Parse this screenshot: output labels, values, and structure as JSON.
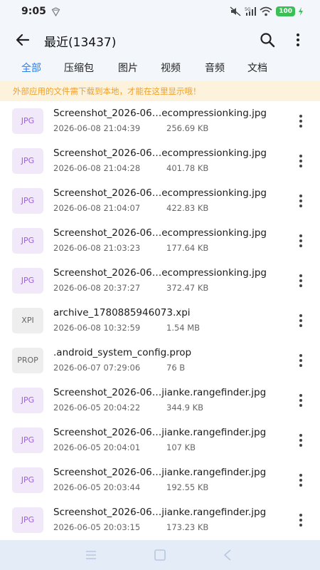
{
  "status": {
    "time": "9:05",
    "battery": "100",
    "network": "5G"
  },
  "header": {
    "title": "最近(13437)"
  },
  "tabs": [
    {
      "label": "全部",
      "active": true
    },
    {
      "label": "压缩包",
      "active": false
    },
    {
      "label": "图片",
      "active": false
    },
    {
      "label": "视频",
      "active": false
    },
    {
      "label": "音频",
      "active": false
    },
    {
      "label": "文档",
      "active": false
    }
  ],
  "notice": "外部应用的文件需下载到本地，才能在这里显示哦！",
  "files": [
    {
      "type": "JPG",
      "name": "Screenshot_2026-06…ecompressionking.jpg",
      "date": "2026-06-08 21:04:39",
      "size": "256.69 KB"
    },
    {
      "type": "JPG",
      "name": "Screenshot_2026-06…ecompressionking.jpg",
      "date": "2026-06-08 21:04:28",
      "size": "401.78 KB"
    },
    {
      "type": "JPG",
      "name": "Screenshot_2026-06…ecompressionking.jpg",
      "date": "2026-06-08 21:04:07",
      "size": "422.83 KB"
    },
    {
      "type": "JPG",
      "name": "Screenshot_2026-06…ecompressionking.jpg",
      "date": "2026-06-08 21:03:23",
      "size": "177.64 KB"
    },
    {
      "type": "JPG",
      "name": "Screenshot_2026-06…ecompressionking.jpg",
      "date": "2026-06-08 20:37:27",
      "size": "372.47 KB"
    },
    {
      "type": "XPI",
      "name": "archive_1780885946073.xpi",
      "date": "2026-06-08 10:32:59",
      "size": "1.54 MB"
    },
    {
      "type": "PROP",
      "name": ".android_system_config.prop",
      "date": "2026-06-07 07:29:06",
      "size": "76 B"
    },
    {
      "type": "JPG",
      "name": "Screenshot_2026-06…jianke.rangefinder.jpg",
      "date": "2026-06-05 20:04:22",
      "size": "344.9 KB"
    },
    {
      "type": "JPG",
      "name": "Screenshot_2026-06…jianke.rangefinder.jpg",
      "date": "2026-06-05 20:04:01",
      "size": "107 KB"
    },
    {
      "type": "JPG",
      "name": "Screenshot_2026-06…jianke.rangefinder.jpg",
      "date": "2026-06-05 20:03:44",
      "size": "192.55 KB"
    },
    {
      "type": "JPG",
      "name": "Screenshot_2026-06…jianke.rangefinder.jpg",
      "date": "2026-06-05 20:03:15",
      "size": "173.23 KB"
    }
  ],
  "colors": {
    "accent": "#2a7ef0",
    "notice_bg": "#fdf3dd",
    "notice_text": "#f0a02a",
    "jpg_badge_bg": "#f1e9f9",
    "jpg_badge_text": "#9a5fd6"
  },
  "icons": {
    "back": "arrow-left-icon",
    "search": "search-icon",
    "more": "more-vertical-icon",
    "nav_menu": "menu-icon",
    "nav_home": "home-square-icon",
    "nav_back": "back-triangle-icon"
  }
}
